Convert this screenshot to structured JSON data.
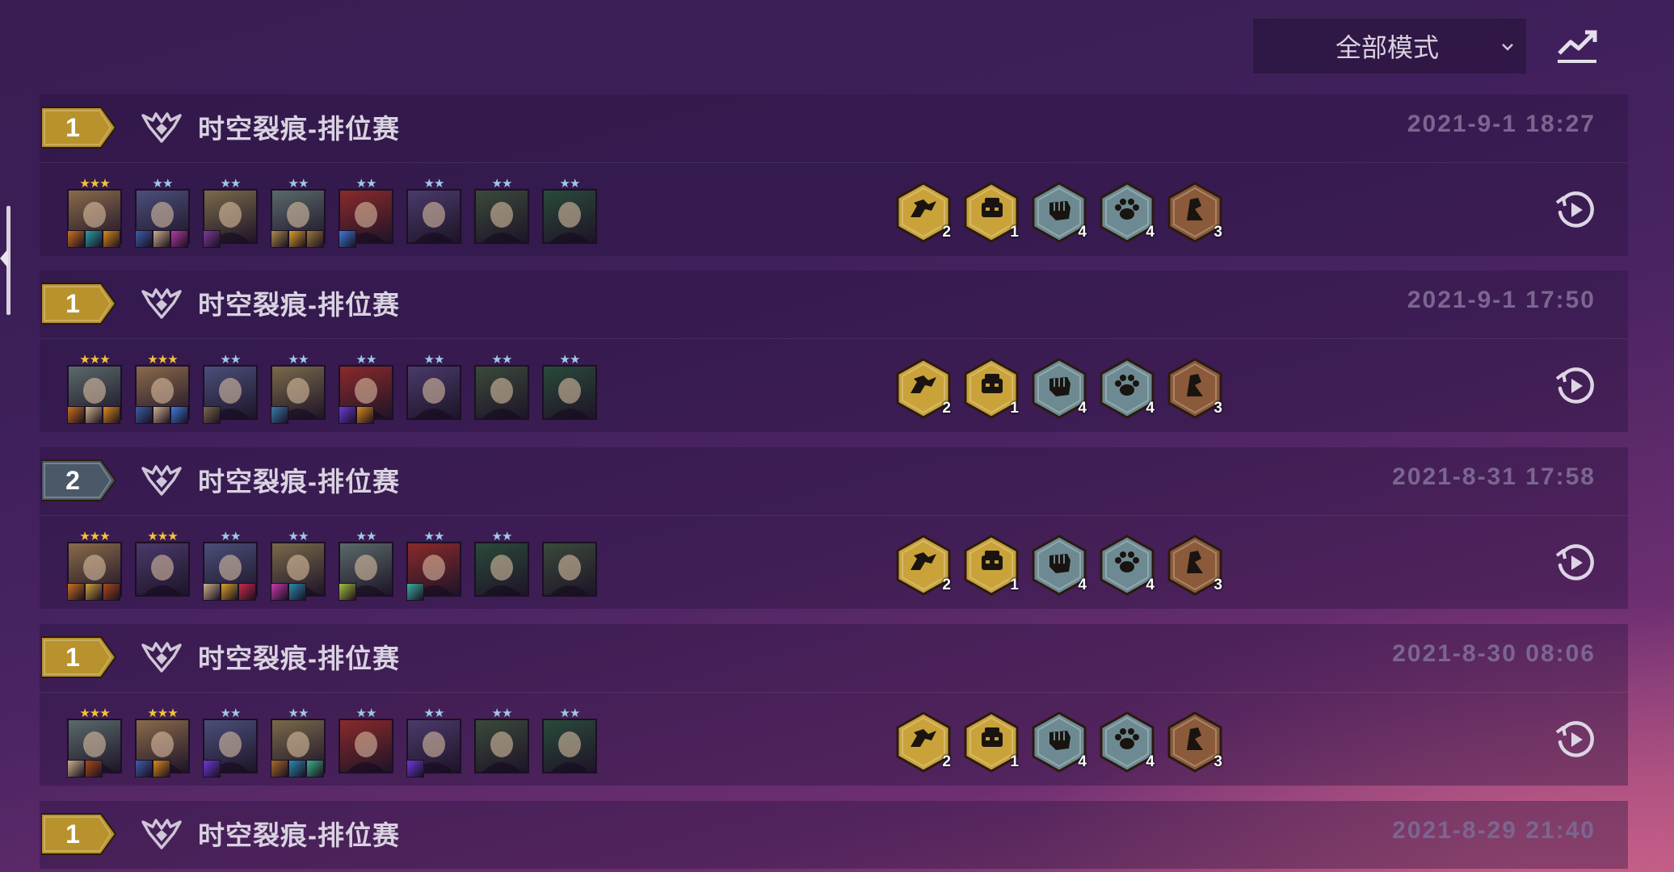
{
  "mode_select": {
    "value": "全部模式",
    "chevron_icon": "chevron-down-icon"
  },
  "trend_icon": "trend-chart-icon",
  "matches": [
    {
      "rank": "1",
      "rank_color": "#b8922c",
      "title": "时空裂痕-排位赛",
      "date": "2021-9-1 18:27",
      "units": [
        {
          "stars": "★★★",
          "star_color": "#f2c33a",
          "bg": "#8a6a4a",
          "items": [
            "#c9721e",
            "#2aa0a6",
            "#d88a1a"
          ]
        },
        {
          "stars": "★★",
          "star_color": "#9ec9e6",
          "bg": "#4b4f7a",
          "items": [
            "#3b5fa8",
            "#c9b08a",
            "#b03aa0"
          ]
        },
        {
          "stars": "★★",
          "star_color": "#9ec9e6",
          "bg": "#7a6a4a",
          "items": [
            "#7a3a9a"
          ]
        },
        {
          "stars": "★★",
          "star_color": "#9ec9e6",
          "bg": "#5a6a6a",
          "items": [
            "#a88a4a",
            "#d8a02a",
            "#9a7a3a"
          ]
        },
        {
          "stars": "★★",
          "star_color": "#9ec9e6",
          "bg": "#8a2a2a",
          "items": [
            "#3a7ad8"
          ]
        },
        {
          "stars": "★★",
          "star_color": "#9ec9e6",
          "bg": "#4a3a6a",
          "items": []
        },
        {
          "stars": "★★",
          "star_color": "#9ec9e6",
          "bg": "#3a4a3a",
          "items": []
        },
        {
          "stars": "★★",
          "star_color": "#9ec9e6",
          "bg": "#2a4a3a",
          "items": []
        }
      ],
      "traits": [
        {
          "icon": "dragon-trait-icon",
          "count": "2",
          "color": "#c9a23a"
        },
        {
          "icon": "mage-trait-icon",
          "count": "1",
          "color": "#c9a23a"
        },
        {
          "icon": "fist-trait-icon",
          "count": "4",
          "color": "#6d8a92"
        },
        {
          "icon": "paw-trait-icon",
          "count": "4",
          "color": "#6d8a92"
        },
        {
          "icon": "person-trait-icon",
          "count": "3",
          "color": "#8a5a3a"
        }
      ]
    },
    {
      "rank": "1",
      "rank_color": "#b8922c",
      "title": "时空裂痕-排位赛",
      "date": "2021-9-1 17:50",
      "units": [
        {
          "stars": "★★★",
          "star_color": "#f2c33a",
          "bg": "#5a6a6a",
          "items": [
            "#c9721e",
            "#c9b08a",
            "#d88a1a"
          ]
        },
        {
          "stars": "★★★",
          "star_color": "#f2c33a",
          "bg": "#8a6a4a",
          "items": [
            "#3b5fa8",
            "#c9b08a",
            "#3b7ad8"
          ]
        },
        {
          "stars": "★★",
          "star_color": "#9ec9e6",
          "bg": "#4b4f7a",
          "items": [
            "#7a6a4a"
          ]
        },
        {
          "stars": "★★",
          "star_color": "#9ec9e6",
          "bg": "#7a6a4a",
          "items": [
            "#3a7aa8"
          ]
        },
        {
          "stars": "★★",
          "star_color": "#9ec9e6",
          "bg": "#8a2a2a",
          "items": [
            "#6a3ad8",
            "#d88a1a"
          ]
        },
        {
          "stars": "★★",
          "star_color": "#9ec9e6",
          "bg": "#4a3a6a",
          "items": []
        },
        {
          "stars": "★★",
          "star_color": "#9ec9e6",
          "bg": "#3a4a3a",
          "items": []
        },
        {
          "stars": "★★",
          "star_color": "#9ec9e6",
          "bg": "#2a4a3a",
          "items": []
        }
      ],
      "traits": [
        {
          "icon": "dragon-trait-icon",
          "count": "2",
          "color": "#c9a23a"
        },
        {
          "icon": "mage-trait-icon",
          "count": "1",
          "color": "#c9a23a"
        },
        {
          "icon": "fist-trait-icon",
          "count": "4",
          "color": "#6d8a92"
        },
        {
          "icon": "paw-trait-icon",
          "count": "4",
          "color": "#6d8a92"
        },
        {
          "icon": "person-trait-icon",
          "count": "3",
          "color": "#8a5a3a"
        }
      ]
    },
    {
      "rank": "2",
      "rank_color": "#4a5868",
      "title": "时空裂痕-排位赛",
      "date": "2021-8-31 17:58",
      "units": [
        {
          "stars": "★★★",
          "star_color": "#f2c33a",
          "bg": "#8a6a4a",
          "items": [
            "#c9721e",
            "#c9a23a",
            "#a84a1a"
          ]
        },
        {
          "stars": "★★★",
          "star_color": "#f2c33a",
          "bg": "#4a3a6a",
          "items": []
        },
        {
          "stars": "★★",
          "star_color": "#9ec9e6",
          "bg": "#4b4f7a",
          "items": [
            "#c9b08a",
            "#d8a02a",
            "#c92a4a"
          ]
        },
        {
          "stars": "★★",
          "star_color": "#9ec9e6",
          "bg": "#7a6a4a",
          "items": [
            "#c93ab0",
            "#2a8ab0"
          ]
        },
        {
          "stars": "★★",
          "star_color": "#9ec9e6",
          "bg": "#5a6a6a",
          "items": [
            "#a8c03a"
          ]
        },
        {
          "stars": "★★",
          "star_color": "#9ec9e6",
          "bg": "#8a2a2a",
          "items": [
            "#3ab0a0"
          ]
        },
        {
          "stars": "★★",
          "star_color": "#9ec9e6",
          "bg": "#2a4a3a",
          "items": []
        },
        {
          "stars": "",
          "star_color": "#9ec9e6",
          "bg": "#3a4a3a",
          "items": []
        }
      ],
      "traits": [
        {
          "icon": "dragon-trait-icon",
          "count": "2",
          "color": "#c9a23a"
        },
        {
          "icon": "mage-trait-icon",
          "count": "1",
          "color": "#c9a23a"
        },
        {
          "icon": "fist-trait-icon",
          "count": "4",
          "color": "#6d8a92"
        },
        {
          "icon": "paw-trait-icon",
          "count": "4",
          "color": "#6d8a92"
        },
        {
          "icon": "person-trait-icon",
          "count": "3",
          "color": "#8a5a3a"
        }
      ]
    },
    {
      "rank": "1",
      "rank_color": "#b8922c",
      "title": "时空裂痕-排位赛",
      "date": "2021-8-30 08:06",
      "units": [
        {
          "stars": "★★★",
          "star_color": "#f2c33a",
          "bg": "#5a6a6a",
          "items": [
            "#c9b08a",
            "#a84a1a"
          ]
        },
        {
          "stars": "★★★",
          "star_color": "#f2c33a",
          "bg": "#8a6a4a",
          "items": [
            "#3b5fa8",
            "#d88a1a"
          ]
        },
        {
          "stars": "★★",
          "star_color": "#9ec9e6",
          "bg": "#4b4f7a",
          "items": [
            "#6a3ad8"
          ]
        },
        {
          "stars": "★★",
          "star_color": "#9ec9e6",
          "bg": "#7a6a4a",
          "items": [
            "#a86a2a",
            "#2a8ab0",
            "#3ab08a"
          ]
        },
        {
          "stars": "★★",
          "star_color": "#9ec9e6",
          "bg": "#8a2a2a",
          "items": []
        },
        {
          "stars": "★★",
          "star_color": "#9ec9e6",
          "bg": "#4a3a6a",
          "items": [
            "#6a3ad8"
          ]
        },
        {
          "stars": "★★",
          "star_color": "#9ec9e6",
          "bg": "#3a4a3a",
          "items": []
        },
        {
          "stars": "★★",
          "star_color": "#9ec9e6",
          "bg": "#2a4a3a",
          "items": []
        }
      ],
      "traits": [
        {
          "icon": "dragon-trait-icon",
          "count": "2",
          "color": "#c9a23a"
        },
        {
          "icon": "mage-trait-icon",
          "count": "1",
          "color": "#c9a23a"
        },
        {
          "icon": "fist-trait-icon",
          "count": "4",
          "color": "#6d8a92"
        },
        {
          "icon": "paw-trait-icon",
          "count": "4",
          "color": "#6d8a92"
        },
        {
          "icon": "person-trait-icon",
          "count": "3",
          "color": "#8a5a3a"
        }
      ]
    },
    {
      "rank": "1",
      "rank_color": "#b8922c",
      "title": "时空裂痕-排位赛",
      "date": "2021-8-29 21:40",
      "units": [],
      "traits": []
    }
  ]
}
